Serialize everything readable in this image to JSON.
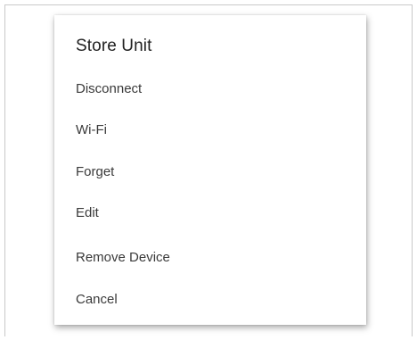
{
  "dialog": {
    "title": "Store Unit",
    "items": [
      {
        "label": "Disconnect"
      },
      {
        "label": "Wi-Fi"
      },
      {
        "label": "Forget"
      },
      {
        "label": "Edit"
      },
      {
        "label": "Remove Device"
      },
      {
        "label": "Cancel"
      }
    ]
  }
}
